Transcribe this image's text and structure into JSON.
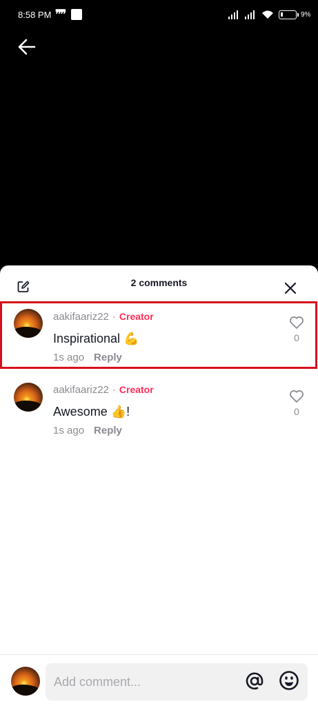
{
  "status_bar": {
    "time": "8:58 PM",
    "battery": "9%",
    "battery_level": 0.09
  },
  "sheet": {
    "title": "2 comments"
  },
  "comments": [
    {
      "username": "aakifaariz22",
      "separator": "·",
      "badge": "Creator",
      "text": "Inspirational 💪",
      "time": "1s ago",
      "reply_label": "Reply",
      "likes": "0",
      "highlighted": true
    },
    {
      "username": "aakifaariz22",
      "separator": "·",
      "badge": "Creator",
      "text": "Awesome 👍!",
      "time": "1s ago",
      "reply_label": "Reply",
      "likes": "0",
      "highlighted": false
    }
  ],
  "composer": {
    "placeholder": "Add comment..."
  },
  "colors": {
    "accent": "#fe2c55",
    "highlight_border": "#d70f1c"
  },
  "icons": [
    "back-arrow-icon",
    "edit-icon",
    "close-icon",
    "heart-icon",
    "at-icon",
    "emoji-icon",
    "signal-icon",
    "wifi-icon",
    "battery-icon"
  ]
}
